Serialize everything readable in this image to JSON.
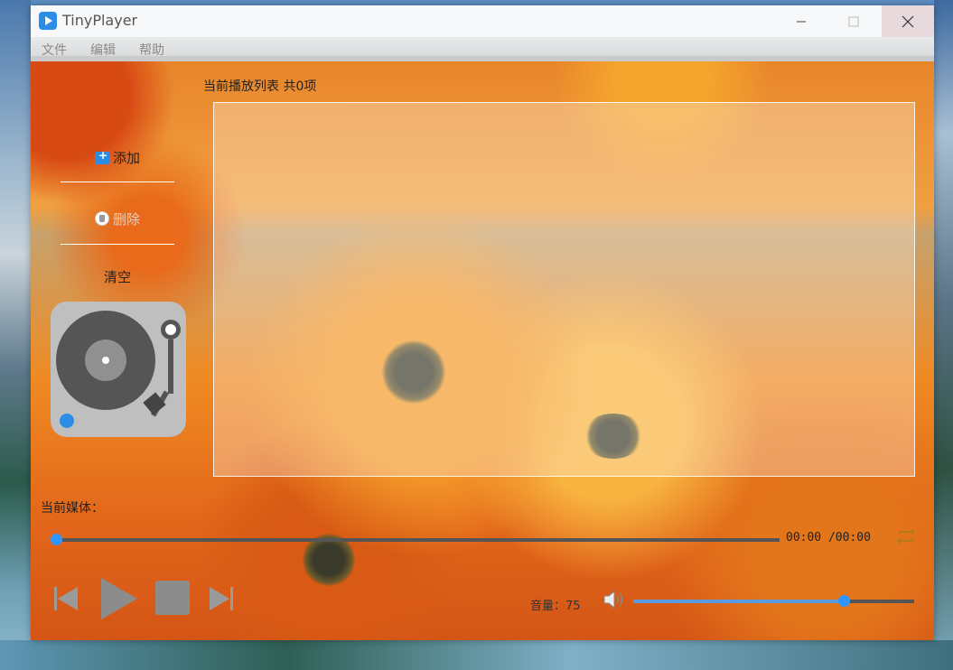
{
  "window": {
    "title": "TinyPlayer"
  },
  "menu": [
    "文件",
    "编辑",
    "帮助"
  ],
  "playlist": {
    "title": "当前播放列表  共0项",
    "count": 0,
    "items": []
  },
  "sidebar": {
    "add_label": "添加",
    "delete_label": "删除",
    "clear_label": "清空"
  },
  "player": {
    "current_media_label": "当前媒体：",
    "progress": 0,
    "time_display": "00:00 /00:00",
    "volume_label": "音量：",
    "volume_value": "75",
    "volume_fraction": 0.75
  },
  "icons": {
    "app": "play-logo-icon",
    "add": "folder-add-icon",
    "delete": "trash-icon",
    "art": "turntable-icon",
    "loop": "loop-icon",
    "prev": "skip-previous-icon",
    "play": "play-icon",
    "stop": "stop-icon",
    "next": "skip-next-icon",
    "volume": "speaker-icon"
  },
  "colors": {
    "accent": "#2f96ff",
    "icon_blue": "#2c8de6",
    "track": "#555555"
  }
}
